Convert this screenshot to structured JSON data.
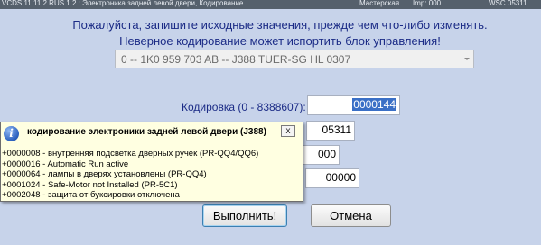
{
  "window": {
    "title": "VCDS 11.11.2 RUS 1.2 : Электроника задней левой двери, Кодирование",
    "status_label": "Мастерская",
    "imp_label": "Imp: 000",
    "wsc_label": "WSC 05311"
  },
  "header": {
    "line1": "Пожалуйста, запишите исходные значения, прежде чем что-либо изменять.",
    "line2": "Неверное кодирование может испортить блок управления!"
  },
  "controller_select": {
    "value": "0 -- 1K0 959 703 AB -- J388   TUER-SG HL   0307"
  },
  "coding": {
    "label": "Кодировка (0 - 8388607):",
    "value": "0000144"
  },
  "fields": {
    "wsc_value": "05311",
    "imp_value": "000",
    "extra_value": "00000"
  },
  "buttons": {
    "execute": "Выполнить!",
    "cancel": "Отмена"
  },
  "tooltip": {
    "title": "кодирование электроники задней левой двери (J388)",
    "close": "x",
    "lines": [
      "+0000008 - внутренняя подсветка дверных ручек (PR-QQ4/QQ6)",
      "+0000016 - Automatic Run active",
      "+0000064 - лампы в дверях установлены (PR-QQ4)",
      "+0001024 - Safe-Motor not Installed (PR-5C1)",
      "+0002048 - защита от буксировки отключена"
    ]
  },
  "icons": {
    "tooltip_icon": "info-icon",
    "select_icon": "chevron-down-icon",
    "close_icon": "close-icon"
  },
  "colors": {
    "background": "#c7d3ea",
    "header_text": "#1b2b86",
    "selection": "#3a6fc6",
    "tooltip_bg": "#ffffe1"
  }
}
